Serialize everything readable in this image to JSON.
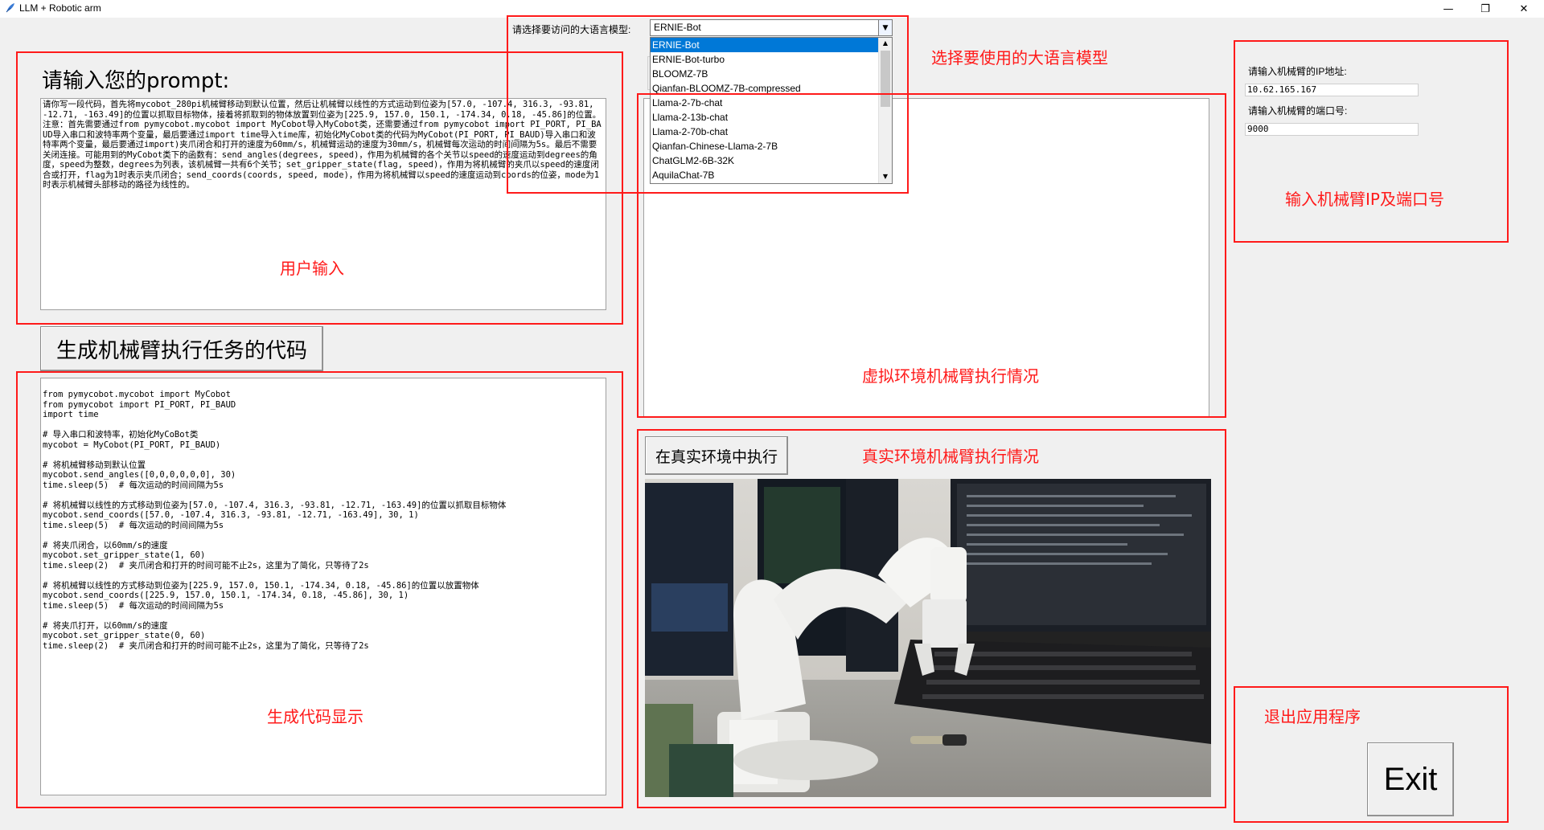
{
  "window": {
    "title": "LLM + Robotic arm",
    "minimize": "—",
    "maximize": "❐",
    "close": "✕"
  },
  "model": {
    "label": "请选择要访问的大语言模型:",
    "selected": "ERNIE-Bot",
    "options": [
      "ERNIE-Bot",
      "ERNIE-Bot-turbo",
      "BLOOMZ-7B",
      "Qianfan-BLOOMZ-7B-compressed",
      "Llama-2-7b-chat",
      "Llama-2-13b-chat",
      "Llama-2-70b-chat",
      "Qianfan-Chinese-Llama-2-7B",
      "ChatGLM2-6B-32K",
      "AquilaChat-7B"
    ]
  },
  "prompt": {
    "heading": "请输入您的prompt:",
    "text": "请你写一段代码，首先将mycobot_280pi机械臂移动到默认位置，然后让机械臂以线性的方式运动到位姿为[57.0, -107.4, 316.3, -93.81, -12.71, -163.49]的位置以抓取目标物体，接着将抓取到的物体放置到位姿为[225.9, 157.0, 150.1, -174.34, 0.18, -45.86]的位置。注意：首先需要通过from pymycobot.mycobot import MyCobot导入MyCobot类，还需要通过from pymycobot import PI_PORT, PI_BAUD导入串口和波特率两个变量，最后要通过import time导入time库，初始化MyCobot类的代码为MyCobot(PI_PORT, PI_BAUD)导入串口和波特率两个变量，最后要通过import)夹爪闭合和打开的速度为60mm/s，机械臂运动的速度为30mm/s，机械臂每次运动的时间间隔为5s。最后不需要关闭连接。可能用到的MyCobot类下的函数有：send_angles(degrees, speed)，作用为机械臂的各个关节以speed的速度运动到degrees的角度，speed为整数，degrees为列表，该机械臂一共有6个关节；set_gripper_state(flag, speed)，作用为将机械臂的夹爪以speed的速度闭合或打开，flag为1时表示夹爪闭合；send_coords(coords, speed, mode)，作用为将机械臂以speed的速度运动到coords的位姿，mode为1时表示机械臂头部移动的路径为线性的。"
  },
  "generate_button": "生成机械臂执行任务的代码",
  "code": {
    "text": "from pymycobot.mycobot import MyCobot\nfrom pymycobot import PI_PORT, PI_BAUD\nimport time\n\n# 导入串口和波特率，初始化MyCoBot类\nmycobot = MyCobot(PI_PORT, PI_BAUD)\n\n# 将机械臂移动到默认位置\nmycobot.send_angles([0,0,0,0,0,0], 30)\ntime.sleep(5)  # 每次运动的时间间隔为5s\n\n# 将机械臂以线性的方式移动到位姿为[57.0, -107.4, 316.3, -93.81, -12.71, -163.49]的位置以抓取目标物体\nmycobot.send_coords([57.0, -107.4, 316.3, -93.81, -12.71, -163.49], 30, 1)\ntime.sleep(5)  # 每次运动的时间间隔为5s\n\n# 将夹爪闭合，以60mm/s的速度\nmycobot.set_gripper_state(1, 60)\ntime.sleep(2)  # 夹爪闭合和打开的时间可能不止2s，这里为了简化，只等待了2s\n\n# 将机械臂以线性的方式移动到位姿为[225.9, 157.0, 150.1, -174.34, 0.18, -45.86]的位置以放置物体\nmycobot.send_coords([225.9, 157.0, 150.1, -174.34, 0.18, -45.86], 30, 1)\ntime.sleep(5)  # 每次运动的时间间隔为5s\n\n# 将夹爪打开，以60mm/s的速度\nmycobot.set_gripper_state(0, 60)\ntime.sleep(2)  # 夹爪闭合和打开的时间可能不止2s，这里为了简化，只等待了2s"
  },
  "real_exec_button": "在真实环境中执行",
  "robot": {
    "ip_label": "请输入机械臂的IP地址:",
    "ip_value": "10.62.165.167",
    "port_label": "请输入机械臂的端口号:",
    "port_value": "9000"
  },
  "exit_button": "Exit",
  "annotations": {
    "user_input": "用户输入",
    "choose_model": "选择要使用的大语言模型",
    "code_display": "生成代码显示",
    "virtual_exec": "虚拟环境机械臂执行情况",
    "real_exec": "真实环境机械臂执行情况",
    "ip_port": "输入机械臂IP及端口号",
    "exit_app": "退出应用程序"
  },
  "colors": {
    "annotation": "#ff1a1a",
    "selection": "#0078d7"
  }
}
